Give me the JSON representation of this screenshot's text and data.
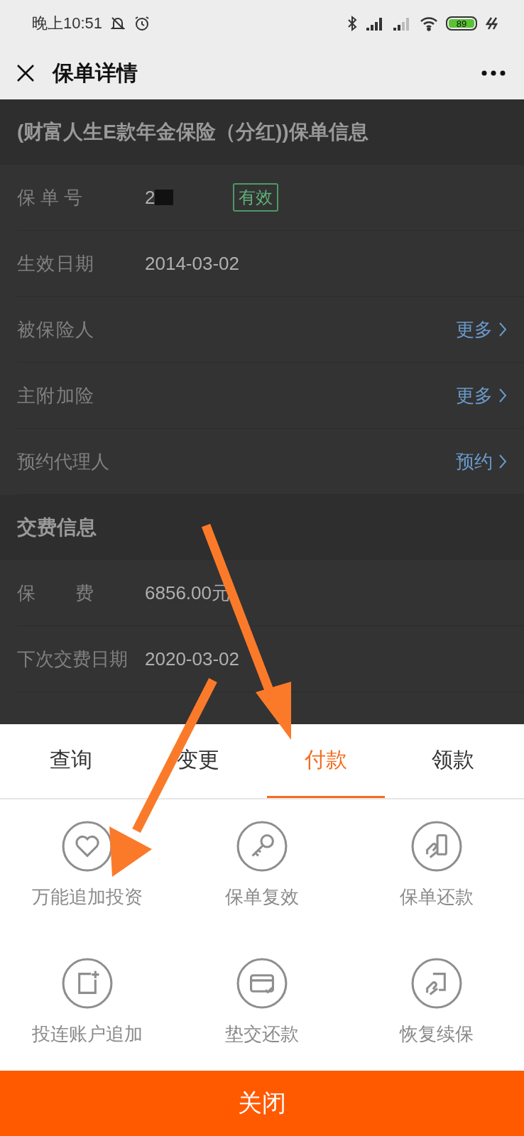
{
  "status_bar": {
    "time": "晚上10:51",
    "battery": "89"
  },
  "nav": {
    "title": "保单详情"
  },
  "sections": [
    {
      "title": "(财富人生E款年金保险（分红))保单信息",
      "rows": [
        {
          "label": "保 单 号",
          "value": "2",
          "badge": "有效"
        },
        {
          "label": "生效日期",
          "value": "2014-03-02"
        },
        {
          "label": "被保险人",
          "link": "更多"
        },
        {
          "label": "主附加险",
          "link": "更多"
        },
        {
          "label": "预约代理人",
          "link": "预约"
        }
      ]
    },
    {
      "title": "交费信息",
      "rows": [
        {
          "label": "保 费",
          "value": "6856.00元"
        },
        {
          "label": "下次交费日期",
          "value": "2020-03-02"
        }
      ]
    }
  ],
  "sheet": {
    "tabs": [
      {
        "label": "查询",
        "selected": false
      },
      {
        "label": "变更",
        "selected": false
      },
      {
        "label": "付款",
        "selected": true
      },
      {
        "label": "领款",
        "selected": false
      }
    ],
    "actions": [
      "万能追加投资",
      "保单复效",
      "保单还款",
      "投连账户追加",
      "垫交还款",
      "恢复续保"
    ],
    "close_button": "关闭"
  }
}
